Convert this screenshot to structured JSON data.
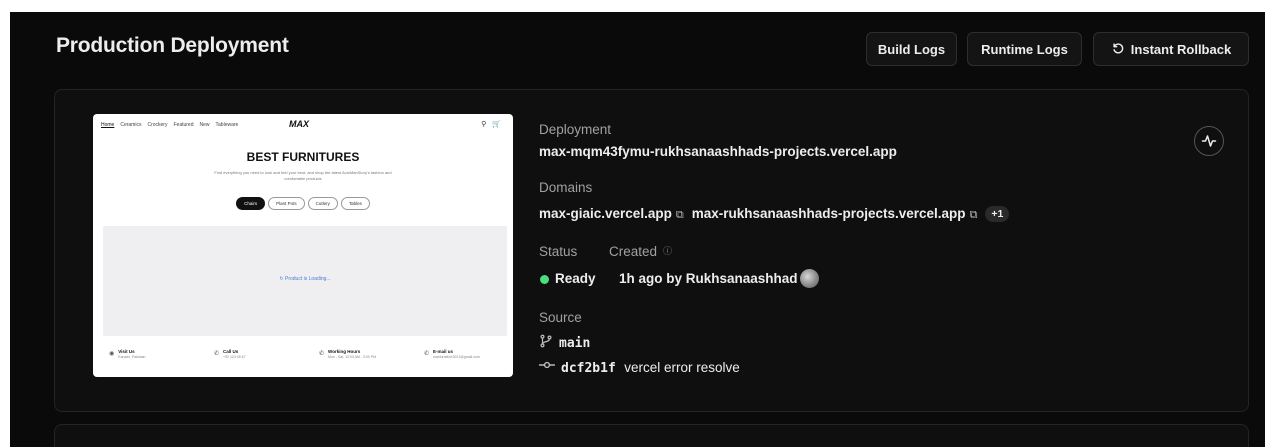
{
  "header": {
    "title": "Production Deployment",
    "build_logs": "Build Logs",
    "runtime_logs": "Runtime Logs",
    "instant_rollback": "Instant Rollback",
    "rollback_icon": "undo-icon"
  },
  "preview": {
    "nav": [
      "Home",
      "Ceramics",
      "Crockery",
      "Featured",
      "New",
      "Tableware"
    ],
    "logo": "MAX",
    "icons": [
      "search-icon",
      "cart-icon"
    ],
    "heading": "BEST FURNITURES",
    "subtitle": "Find everything you need to look and feel your best, and shop the latest Ava/ManStory's fashion and comfortable products",
    "chips": [
      "Chairs",
      "Plant Pots",
      "Cutlery",
      "Tables"
    ],
    "loading": "Product is Loading...",
    "footer": [
      {
        "title": "Visit Us",
        "sub": "Karachi, Pakistan",
        "icon": "location-icon"
      },
      {
        "title": "Call Us",
        "sub": "+92 123 45 67",
        "icon": "phone-icon"
      },
      {
        "title": "Working Hours",
        "sub": "Mon - Sat, 10:00 AM - 3:00 PM",
        "icon": "phone-icon"
      },
      {
        "title": "E-mail us",
        "sub": "maxfurniture2021@gmail.com",
        "icon": "phone-icon"
      }
    ]
  },
  "deployment": {
    "label": "Deployment",
    "url": "max-mqm43fymu-rukhsanaashhads-projects.vercel.app"
  },
  "domains": {
    "label": "Domains",
    "items": [
      "max-giaic.vercel.app",
      "max-rukhsanaashhads-projects.vercel.app"
    ],
    "extra": "+1"
  },
  "status": {
    "label": "Status",
    "value": "Ready",
    "color": "#4ade80"
  },
  "created": {
    "label": "Created",
    "value": "1h ago by Rukhsanaashhad"
  },
  "source": {
    "label": "Source",
    "branch": "main",
    "commit_hash": "dcf2b1f",
    "commit_message": "vercel error resolve"
  },
  "activity_icon": "activity-icon"
}
